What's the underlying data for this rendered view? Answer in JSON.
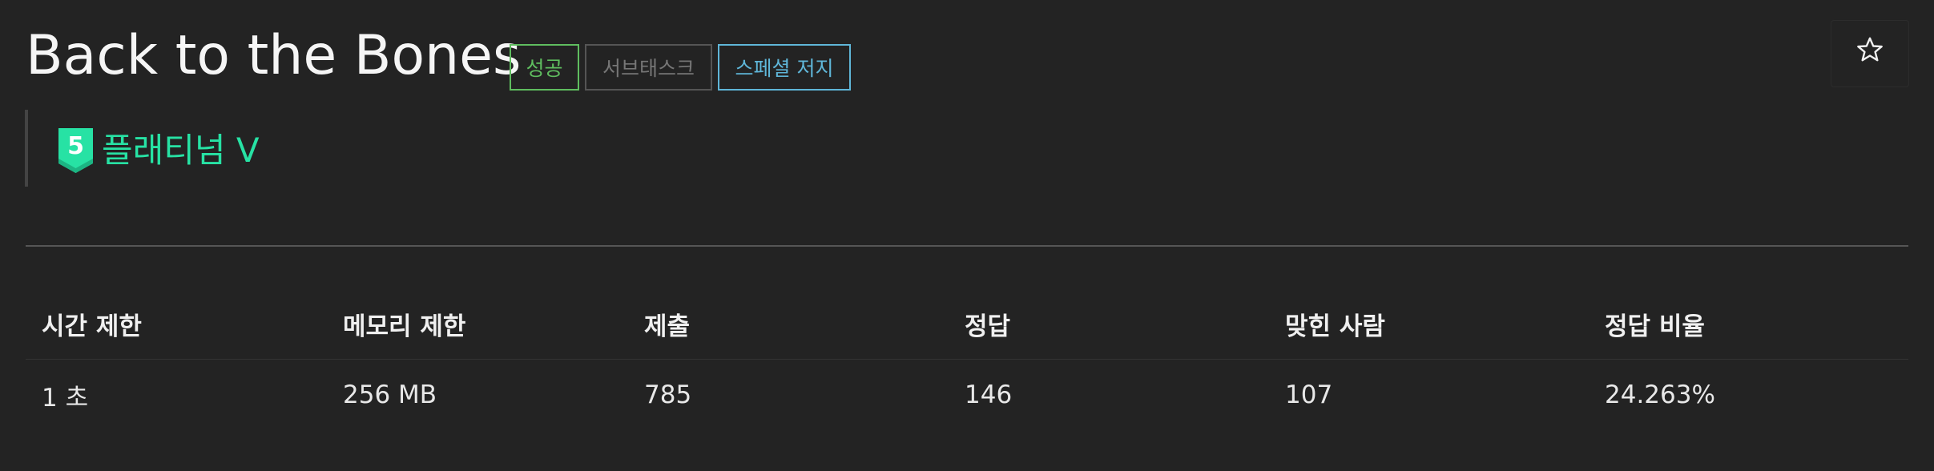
{
  "problem": {
    "title": "Back to the Bones",
    "badges": [
      {
        "label": "성공",
        "color": "#5fbd5f"
      },
      {
        "label": "서브태스크",
        "color": "#767676"
      },
      {
        "label": "스페셜 저지",
        "color": "#5fb6d8"
      }
    ],
    "star_icon": "star-outline-icon",
    "tier": {
      "level": "5",
      "label": "플래티넘 V",
      "color": "#27e2a4",
      "icon": "tier-platinum-icon"
    }
  },
  "info_table": {
    "headers": [
      "시간 제한",
      "메모리 제한",
      "제출",
      "정답",
      "맞힌 사람",
      "정답 비율"
    ],
    "values": [
      "1 초",
      "256 MB",
      "785",
      "146",
      "107",
      "24.263%"
    ]
  }
}
